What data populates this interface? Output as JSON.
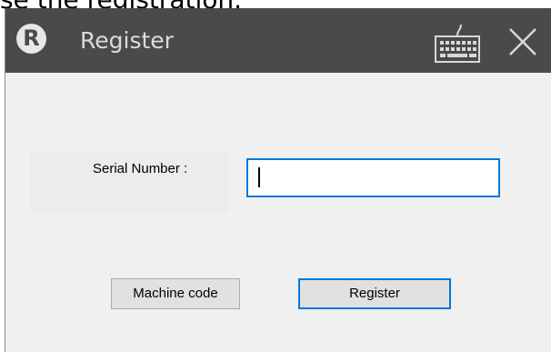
{
  "caption": "se the registration.",
  "window": {
    "title": "Register",
    "logo_glyph": "R",
    "icons": {
      "logo": "registered-trademark-icon",
      "keyboard": "keyboard-icon",
      "close": "close-icon"
    },
    "colors": {
      "titlebar": "#4a4a4a",
      "title_text": "#dcdcdc",
      "body": "#f0f0f0",
      "accent": "#0078d7"
    }
  },
  "form": {
    "serial_label": "Serial Number :",
    "serial_value": ""
  },
  "buttons": {
    "machine_code": "Machine code",
    "register": "Register"
  }
}
